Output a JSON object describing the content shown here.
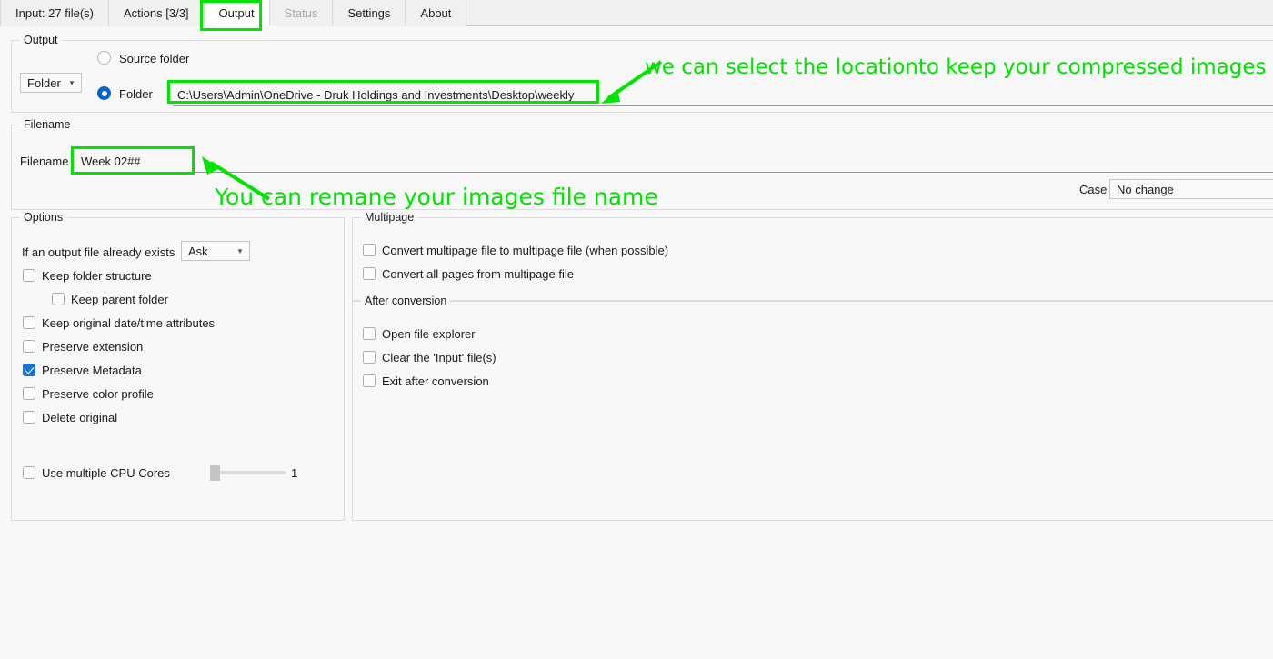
{
  "window": {
    "accent_green": "#00e400",
    "accent_blue": "#0a62c7"
  },
  "tabs": [
    {
      "label": "Input: 27 file(s)",
      "state": "normal"
    },
    {
      "label": "Actions [3/3]",
      "state": "normal"
    },
    {
      "label": "Output",
      "state": "active"
    },
    {
      "label": "Status",
      "state": "disabled"
    },
    {
      "label": "Settings",
      "state": "normal"
    },
    {
      "label": "About",
      "state": "normal"
    }
  ],
  "output_group": {
    "legend": "Output",
    "mode_select": {
      "value": "Folder",
      "chevron": "chevron-down-icon"
    },
    "source_folder_radio": {
      "label": "Source folder",
      "selected": false
    },
    "folder_radio": {
      "label": "Folder",
      "selected": true
    },
    "folder_path": {
      "value": "C:\\Users\\Admin\\OneDrive - Druk Holdings and Investments\\Desktop\\weekly"
    }
  },
  "filename_group": {
    "legend": "Filename",
    "field_label": "Filename",
    "filename_value": "Week 02##",
    "case_label": "Case",
    "case_select": {
      "value": "No change",
      "chevron": "chevron-down-icon"
    }
  },
  "options_group": {
    "legend": "Options",
    "exists_label": "If an output file already exists",
    "exists_select": {
      "value": "Ask",
      "chevron": "chevron-down-icon"
    },
    "checkboxes": [
      {
        "label": "Keep folder structure",
        "checked": false,
        "indent": 0
      },
      {
        "label": "Keep parent folder",
        "checked": false,
        "indent": 1
      },
      {
        "label": "Keep original date/time attributes",
        "checked": false,
        "indent": 0
      },
      {
        "label": "Preserve extension",
        "checked": false,
        "indent": 0
      },
      {
        "label": "Preserve Metadata",
        "checked": true,
        "indent": 0
      },
      {
        "label": "Preserve color profile",
        "checked": false,
        "indent": 0
      },
      {
        "label": "Delete original",
        "checked": false,
        "indent": 0
      }
    ],
    "cpu": {
      "label": "Use multiple CPU Cores",
      "checked": false,
      "slider_value": "1"
    }
  },
  "multipage_group": {
    "legend": "Multipage",
    "checkboxes": [
      {
        "label": "Convert multipage file to multipage file (when possible)",
        "checked": false
      },
      {
        "label": "Convert all pages from multipage file",
        "checked": false
      }
    ]
  },
  "after_conversion_group": {
    "legend": "After conversion",
    "checkboxes": [
      {
        "label": "Open file explorer",
        "checked": false
      },
      {
        "label": "Clear the 'Input' file(s)",
        "checked": false
      },
      {
        "label": "Exit after conversion",
        "checked": false
      }
    ]
  },
  "annotations": [
    {
      "text": "we can select the locationto keep your compressed images"
    },
    {
      "text": "You can remane your images file name"
    }
  ]
}
